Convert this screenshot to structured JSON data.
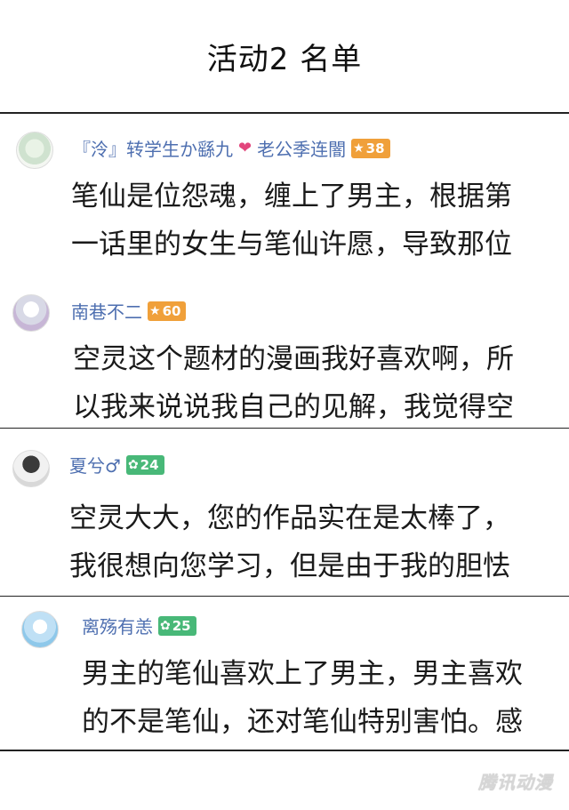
{
  "title": "活动2  名单",
  "comments": [
    {
      "username": "『泠』转学生か繇九",
      "username_suffix": "老公季连闇",
      "level": "38",
      "lines": [
        "笔仙是位怨魂，缠上了男主，根据第",
        "一话里的女生与笔仙许愿，导致那位"
      ]
    },
    {
      "username": "南巷不二",
      "level": "60",
      "lines": [
        "空灵这个题材的漫画我好喜欢啊，所",
        "以我来说说我自己的见解，我觉得空"
      ]
    },
    {
      "username": "夏兮♂",
      "level": "24",
      "lines": [
        "空灵大大，您的作品实在是太棒了，",
        "我很想向您学习，但是由于我的胆怯"
      ]
    },
    {
      "username": "离殇有恙",
      "level": "25",
      "lines": [
        "男主的笔仙喜欢上了男主，男主喜欢",
        "的不是笔仙，还对笔仙特别害怕。感"
      ]
    }
  ],
  "watermark": "腾讯动漫",
  "colors": {
    "username": "#4e6fb0",
    "badge_orange": "#f0a03a",
    "badge_green": "#48b878",
    "heart": "#e2457c"
  }
}
